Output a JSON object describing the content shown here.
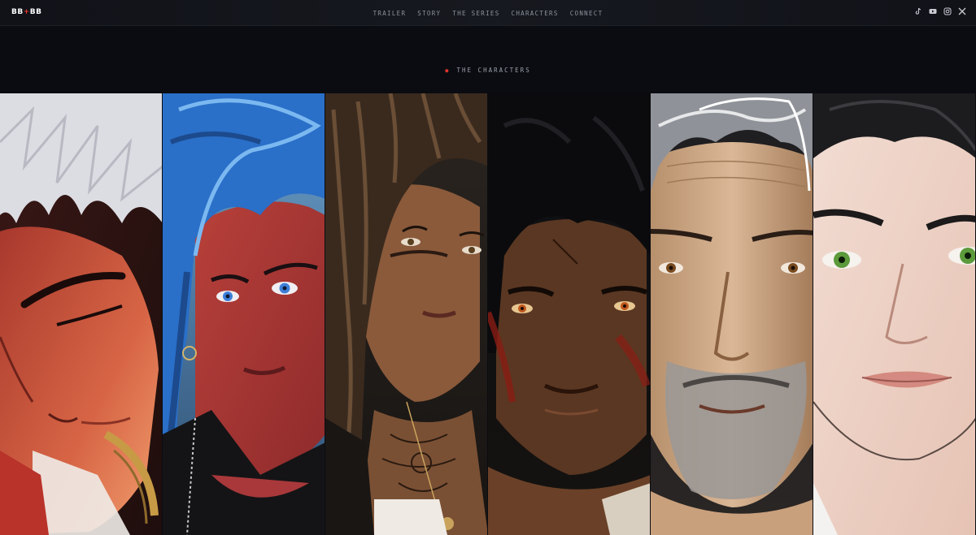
{
  "brand": {
    "logo_left": "BB",
    "logo_plus": "+",
    "logo_right": "BB",
    "accent": "#e0352b"
  },
  "nav": {
    "items": [
      {
        "label": "TRAILER"
      },
      {
        "label": "STORY"
      },
      {
        "label": "THE SERIES"
      },
      {
        "label": "CHARACTERS"
      },
      {
        "label": "CONNECT"
      }
    ]
  },
  "social": {
    "icons": [
      "tiktok-icon",
      "youtube-icon",
      "instagram-icon",
      "x-icon"
    ]
  },
  "section": {
    "label": "THE CHARACTERS"
  },
  "characters": {
    "portraits": [
      {
        "hair": "white",
        "skin": "warm-red-lit"
      },
      {
        "hair": "blue",
        "skin": "red-lit"
      },
      {
        "hair": "braids",
        "skin": "brown"
      },
      {
        "hair": "black",
        "skin": "dark-scarred"
      },
      {
        "hair": "grey",
        "skin": "tan-bearded"
      },
      {
        "hair": "black-short",
        "skin": "pale"
      }
    ]
  }
}
